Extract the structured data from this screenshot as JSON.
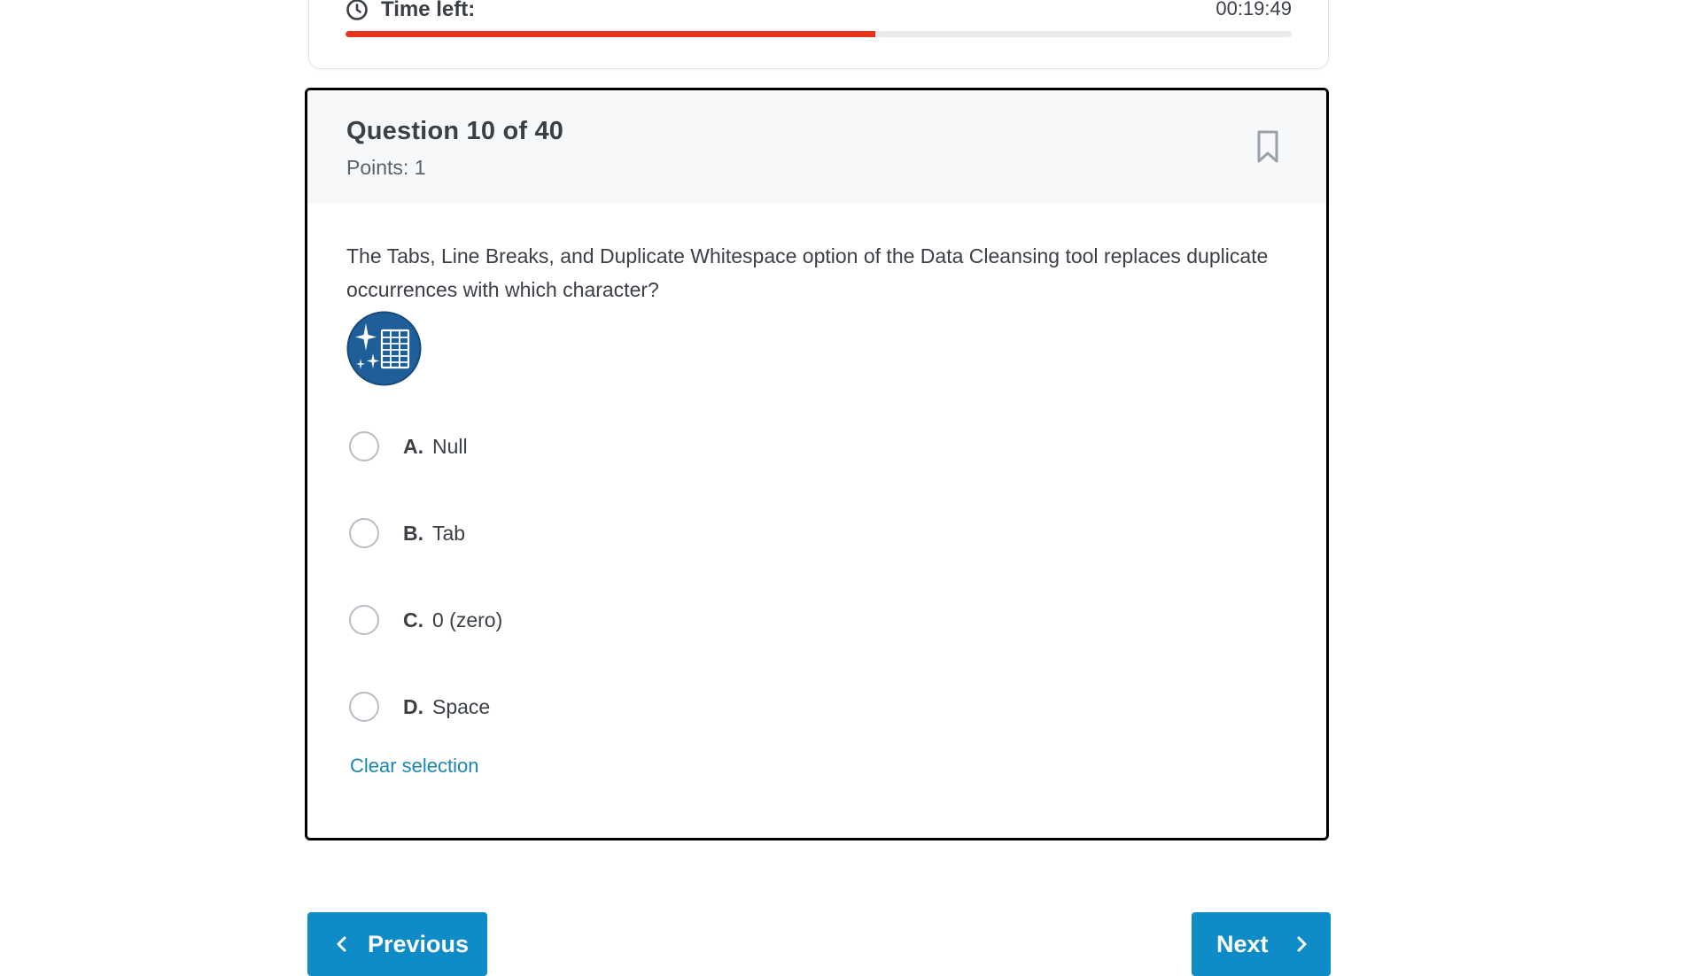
{
  "timer": {
    "label": "Time left:",
    "value": "00:19:49",
    "progress_fraction": 0.56,
    "progress_color": "#e8331c",
    "icon": "clock-icon"
  },
  "question": {
    "title": "Question 10 of 40",
    "points": "Points: 1",
    "text": "The Tabs, Line Breaks, and Duplicate Whitespace option of the Data Cleansing tool replaces duplicate occurrences with which character?",
    "bookmark_icon": "bookmark-icon",
    "image_icon": "data-cleansing-tool-icon"
  },
  "options": [
    {
      "letter": "A.",
      "text": "Null"
    },
    {
      "letter": "B.",
      "text": "Tab"
    },
    {
      "letter": "C.",
      "text": "0 (zero)"
    },
    {
      "letter": "D.",
      "text": "Space"
    }
  ],
  "clear_selection": "Clear selection",
  "nav": {
    "previous": "Previous",
    "next": "Next",
    "accent": "#0f8cc7"
  },
  "colors": {
    "link": "#1a86b5",
    "text": "#3b4046"
  }
}
